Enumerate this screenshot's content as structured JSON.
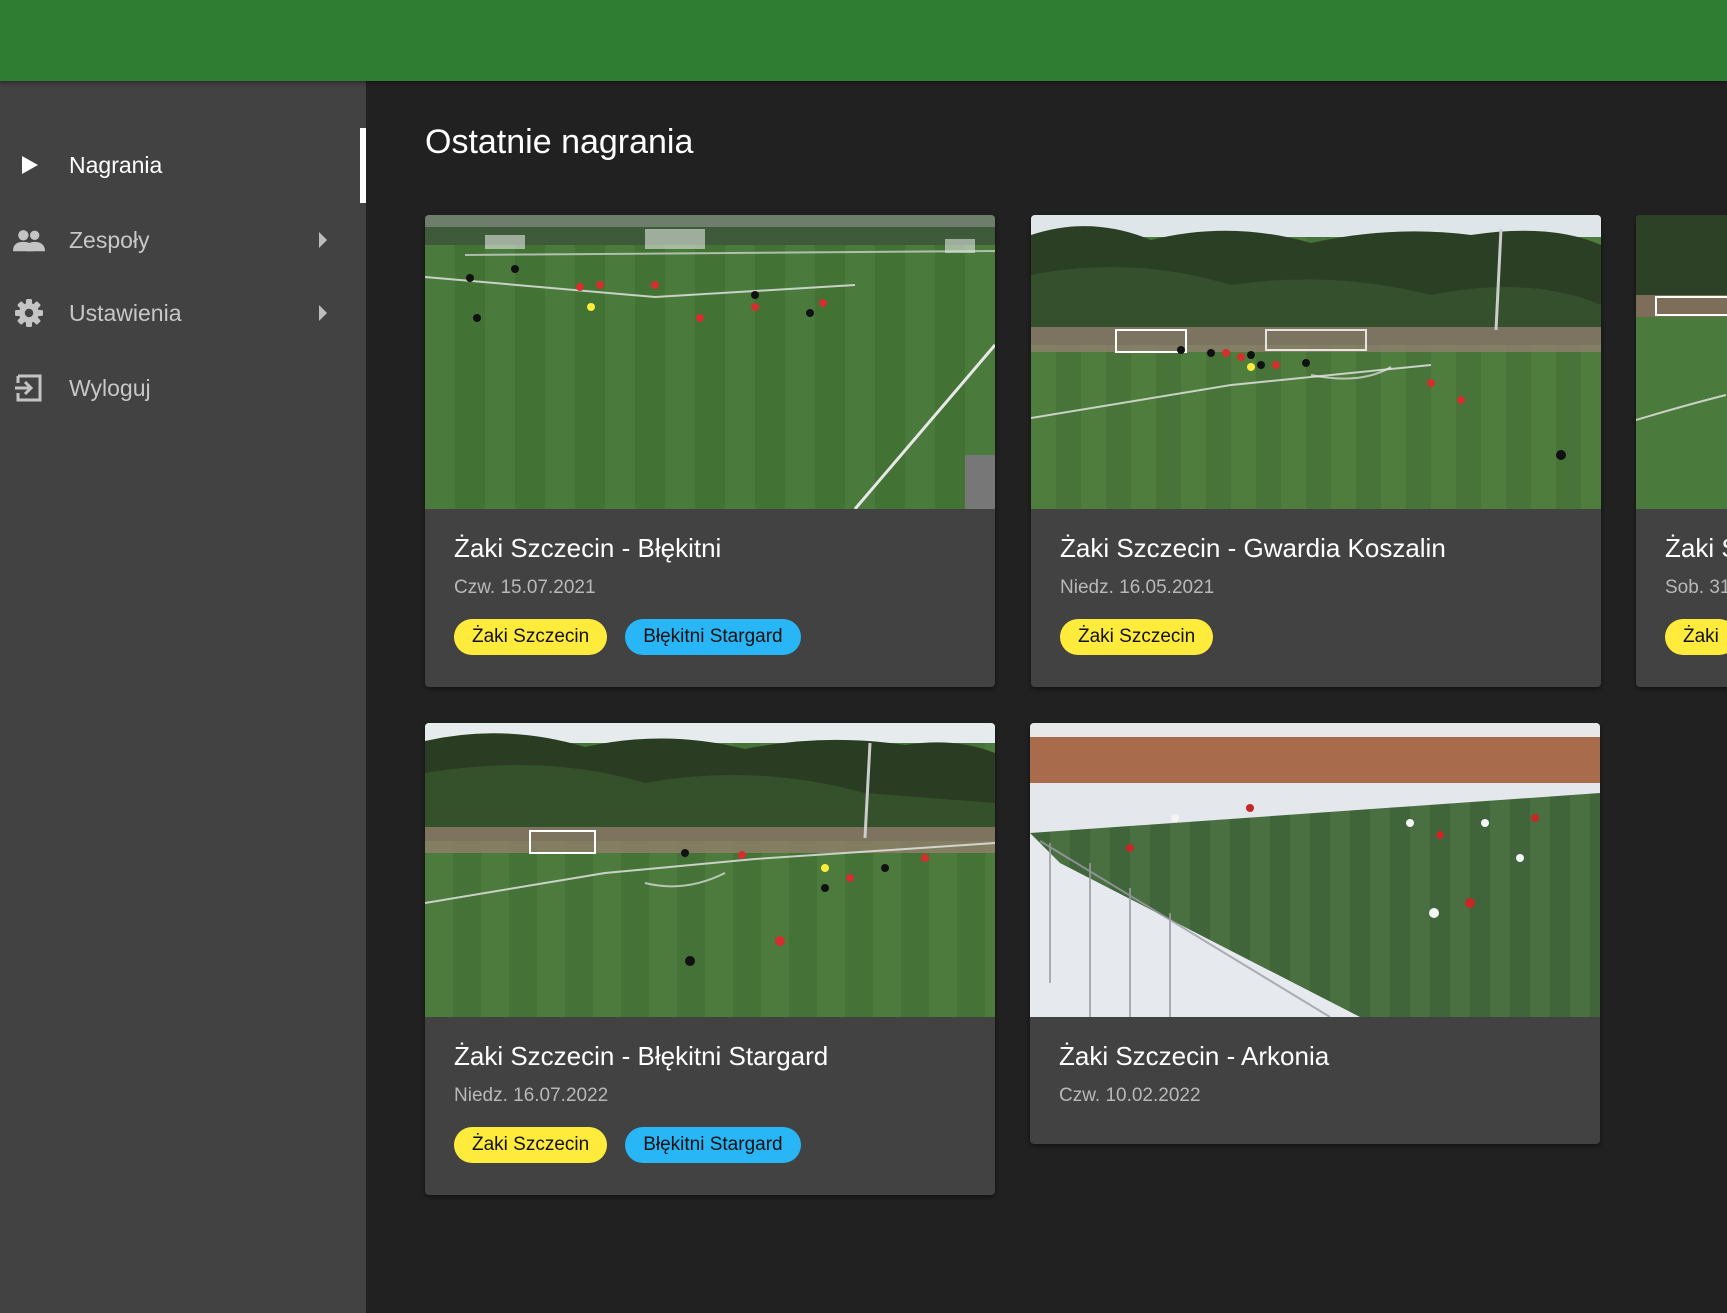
{
  "colors": {
    "topbar": "#2e7d32",
    "sidebar": "#424242",
    "background": "#212121",
    "card": "#424242",
    "chip_home": "#ffeb3b",
    "chip_away": "#29b6f6"
  },
  "sidebar": {
    "items": [
      {
        "label": "Nagrania",
        "icon": "play-icon",
        "active": true
      },
      {
        "label": "Zespoły",
        "icon": "people-icon",
        "has_submenu": true
      },
      {
        "label": "Ustawienia",
        "icon": "gear-icon",
        "has_submenu": true
      },
      {
        "label": "Wyloguj",
        "icon": "logout-icon"
      }
    ]
  },
  "main": {
    "title": "Ostatnie nagrania",
    "recordings": [
      {
        "title": "Żaki Szczecin - Błękitni",
        "date": "Czw. 15.07.2021",
        "teams": [
          "Żaki Szczecin",
          "Błękitni Stargard"
        ]
      },
      {
        "title": "Żaki Szczecin - Gwardia Koszalin",
        "date": "Niedz. 16.05.2021",
        "teams": [
          "Żaki Szczecin"
        ]
      },
      {
        "title": "Żaki S",
        "date": "Sob. 31",
        "teams": [
          "Żaki"
        ]
      },
      {
        "title": "Żaki Szczecin - Błękitni Stargard",
        "date": "Niedz. 16.07.2022",
        "teams": [
          "Żaki Szczecin",
          "Błękitni Stargard"
        ]
      },
      {
        "title": "Żaki Szczecin - Arkonia",
        "date": "Czw. 10.02.2022",
        "teams": []
      }
    ]
  }
}
